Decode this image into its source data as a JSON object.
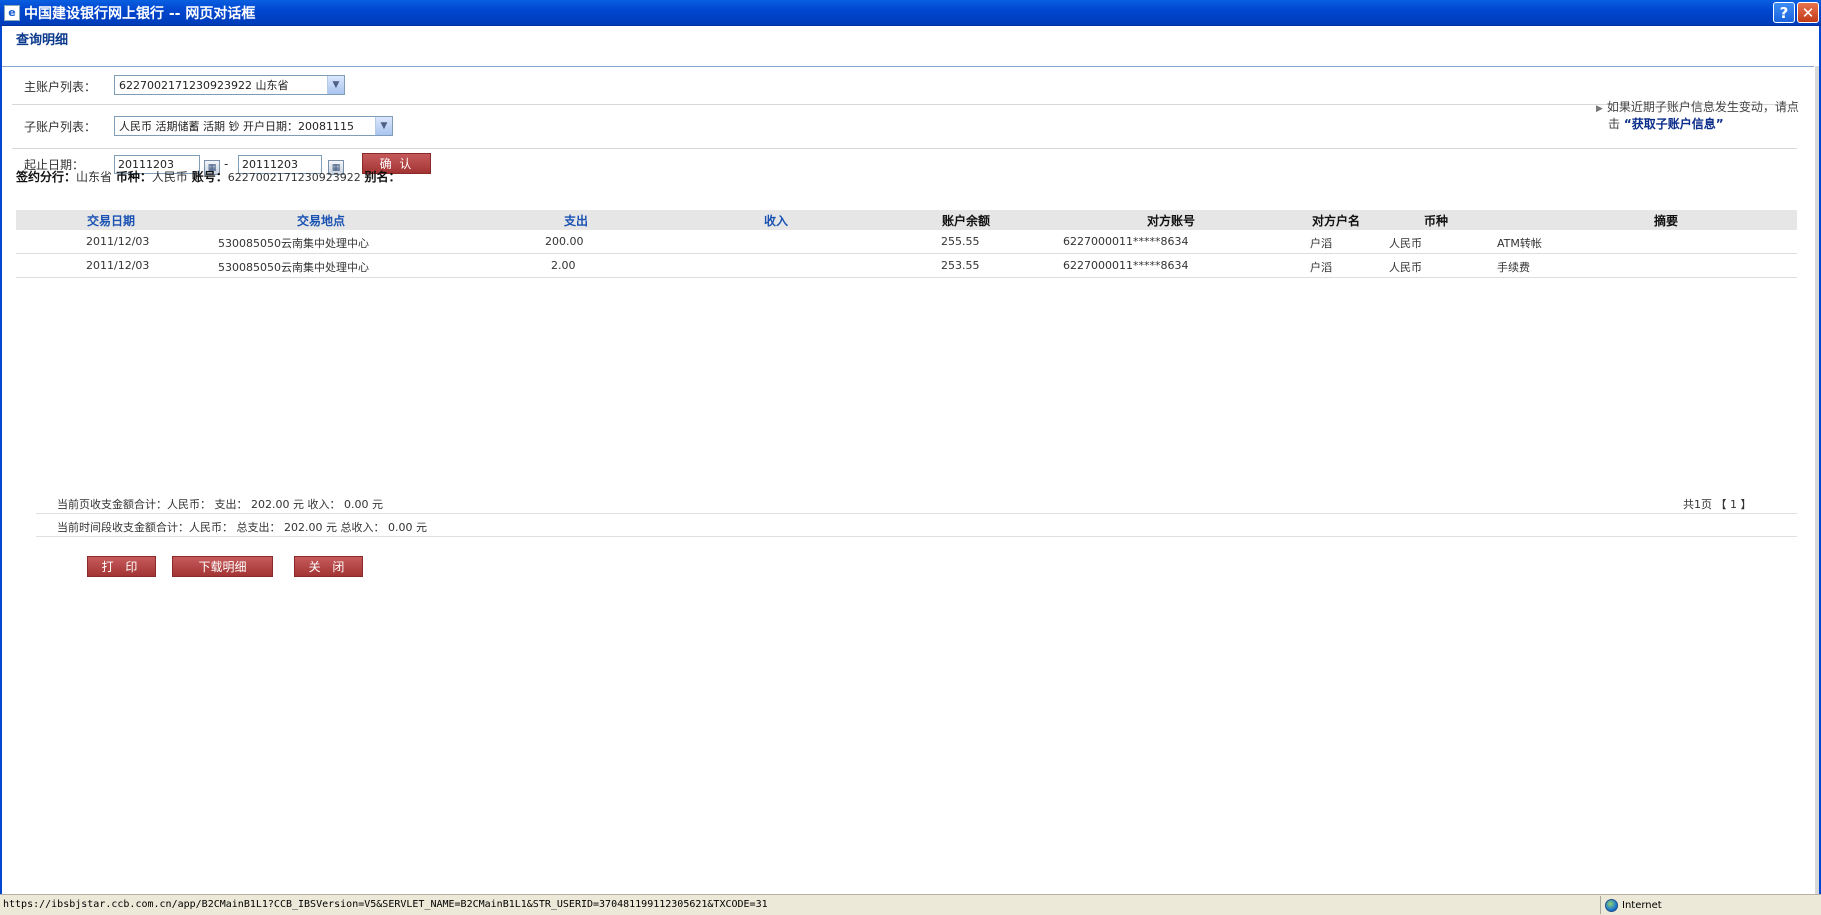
{
  "window": {
    "title": "中国建设银行网上银行  --  网页对话框",
    "help_glyph": "?",
    "close_glyph": "✕"
  },
  "page": {
    "header": "查询明细"
  },
  "form": {
    "main_account_label": "主账户列表：",
    "main_account_value": "6227002171230923922        山东省",
    "sub_account_label": "子账户列表：",
    "sub_account_value": "人民币 活期储蓄 活期 钞 开户日期：20081115",
    "date_label": "起止日期：",
    "date_from": "20111203",
    "date_to": "20111203",
    "date_sep": "-",
    "confirm_label": "确 认"
  },
  "notice": {
    "text": "如果近期子账户信息发生变动，请点",
    "text2": "击",
    "link": "“获取子账户信息”"
  },
  "account_info": {
    "branch_label": "签约分行：",
    "branch_value": "山东省",
    "currency_label": "币种：",
    "currency_value": "人民币",
    "account_label": "账号：",
    "account_value": "6227002171230923922",
    "alias_label": "别名："
  },
  "table": {
    "headers": [
      "交易日期",
      "交易地点",
      "支出",
      "收入",
      "账户余额",
      "对方账号",
      "对方户名",
      "币种",
      "摘要"
    ],
    "rows": [
      [
        "2011/12/03",
        "530085050云南集中处理中心",
        "200.00",
        "",
        "255.55",
        "6227000011*****8634",
        "户滔",
        "人民币",
        "ATM转帐"
      ],
      [
        "2011/12/03",
        "530085050云南集中处理中心",
        "2.00",
        "",
        "253.55",
        "6227000011*****8634",
        "户滔",
        "人民币",
        "手续费"
      ]
    ]
  },
  "summary": {
    "page_total": "当前页收支金额合计：人民币：  支出：  202.00 元   收入：  0.00 元",
    "period_total": "当前时间段收支金额合计：人民币：  总支出：  202.00 元   总收入：  0.00 元",
    "pagination": "共1页   【 1 】"
  },
  "buttons": {
    "print": "打 印",
    "download": "下载明细",
    "close": "关 闭"
  },
  "statusbar": {
    "url": "https://ibsbjstar.ccb.com.cn/app/B2CMainB1L1?CCB_IBSVersion=V5&SERVLET_NAME=B2CMainB1L1&STR_USERID=370481199112305621&TXCODE=31",
    "zone": "Internet"
  }
}
